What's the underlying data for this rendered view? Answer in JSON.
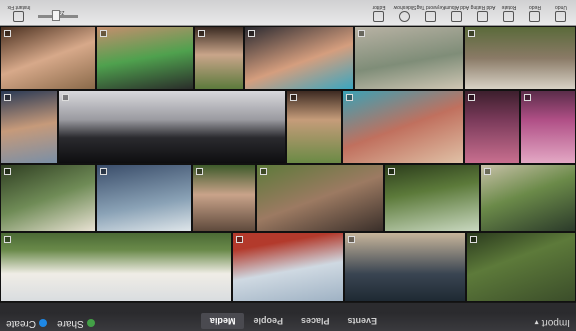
{
  "topbar": {
    "import_label": "Import",
    "view_tabs": [
      "Media",
      "People",
      "Places",
      "Events"
    ],
    "active_tab": "Media",
    "create_label": "Create",
    "share_label": "Share",
    "create_color": "#1e88e5",
    "share_color": "#43a047"
  },
  "toolbar": {
    "tools": [
      "Undo",
      "Redo",
      "Rotate",
      "Add Rating",
      "Add Album",
      "Keyword Tag",
      "Slideshow",
      "Editor",
      "Instant Fix"
    ],
    "zoom_label": "Zoom",
    "right_tools": [
      "Instant Fix",
      "Editor"
    ]
  }
}
